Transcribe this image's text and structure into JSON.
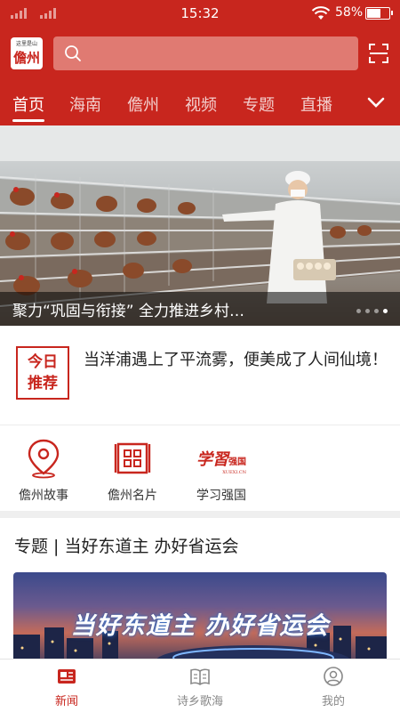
{
  "status_bar": {
    "time": "15:32",
    "battery_percent": "58%",
    "battery_level": 0.58
  },
  "header": {
    "logo_small_text": "这里是山",
    "logo_text": "儋州",
    "search_placeholder": ""
  },
  "tabs": [
    {
      "label": "首页",
      "active": true
    },
    {
      "label": "海南"
    },
    {
      "label": "儋州"
    },
    {
      "label": "视频"
    },
    {
      "label": "专题"
    },
    {
      "label": "直播"
    }
  ],
  "banner": {
    "caption": "聚力“巩固与衔接” 全力推进乡村…",
    "slide_count": 4,
    "active_slide": 3
  },
  "today": {
    "stamp_line1": "今日",
    "stamp_line2": "推荐",
    "text": "当洋浦遇上了平流雾，便美成了人间仙境！"
  },
  "quick_entries": [
    {
      "label": "儋州故事",
      "icon": "location-pin-icon"
    },
    {
      "label": "儋州名片",
      "icon": "card-grid-icon"
    },
    {
      "label": "学习强国",
      "icon": "xuexi-qiangguo-logo",
      "logo_text": "学習",
      "logo_badge": "强国",
      "logo_sub": "XUEXI.CN"
    }
  ],
  "topic": {
    "title": "专题 | 当好东道主 办好省运会",
    "banner_text": "当好东道主 办好省运会"
  },
  "bottom_nav": [
    {
      "label": "新闻",
      "active": true,
      "icon": "news-icon"
    },
    {
      "label": "诗乡歌海",
      "icon": "book-icon"
    },
    {
      "label": "我的",
      "icon": "user-icon"
    }
  ],
  "colors": {
    "brand_red": "#c8261e",
    "search_bg": "#e07a72"
  }
}
